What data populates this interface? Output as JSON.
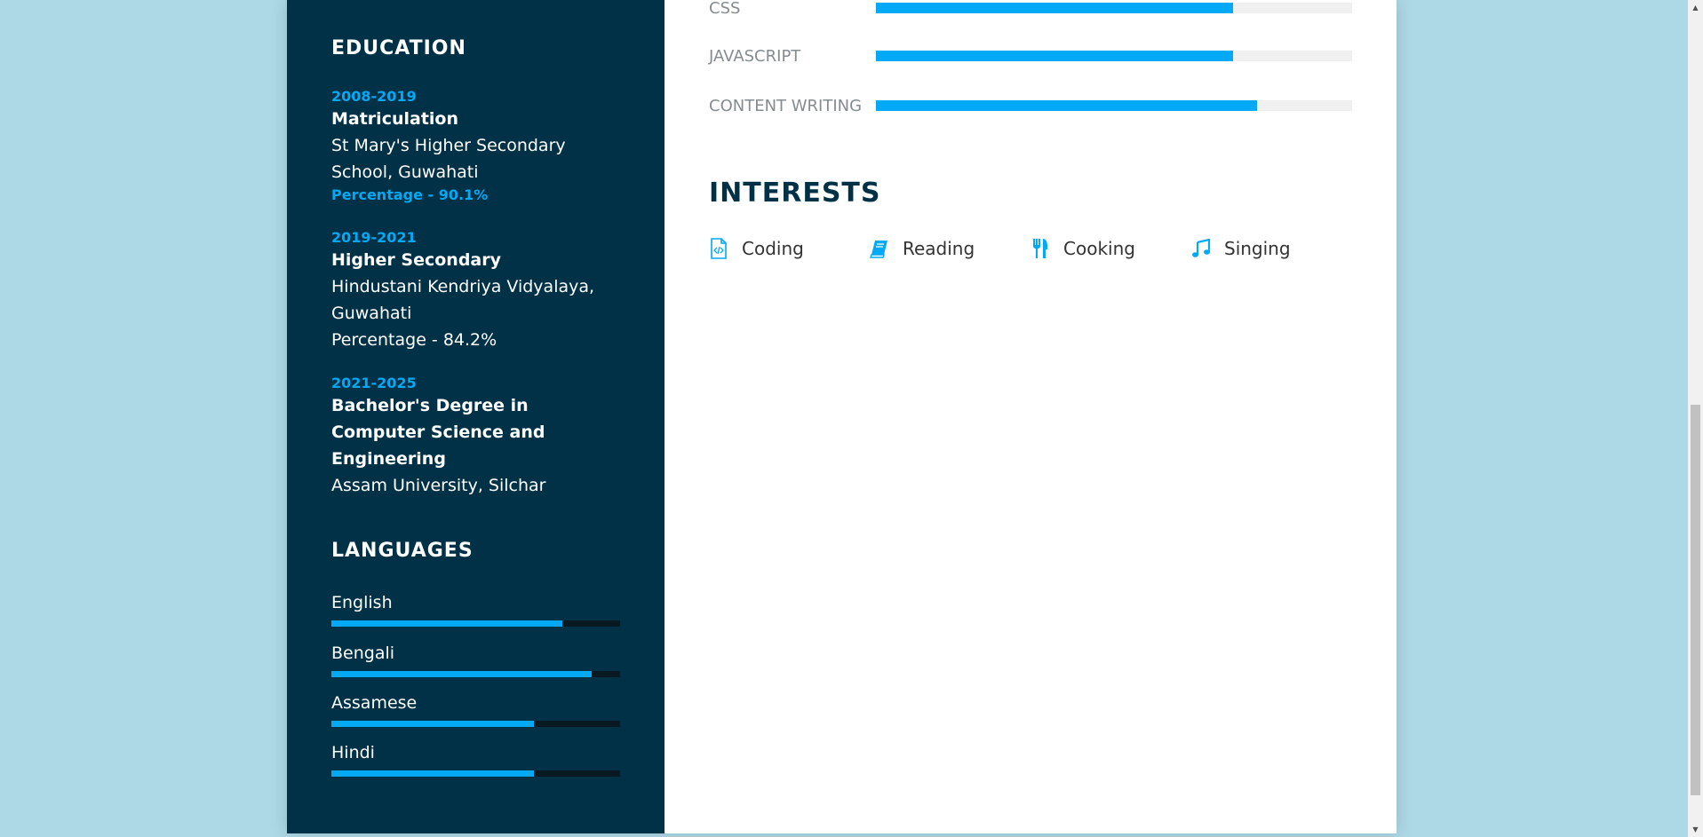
{
  "education": {
    "title": "EDUCATION",
    "items": [
      {
        "year": "2008-2019",
        "degree": "Matriculation",
        "school": "St Mary's Higher Secondary School, Guwahati",
        "percentage": "Percentage - 90.1%"
      },
      {
        "year": "2019-2021",
        "degree": "Higher Secondary",
        "school": "Hindustani Kendriya Vidyalaya, Guwahati",
        "percentage": "Percentage - 84.2%"
      },
      {
        "year": "2021-2025",
        "degree": "Bachelor's Degree in Computer Science and Engineering",
        "school": "Assam University, Silchar"
      }
    ]
  },
  "languages": {
    "title": "LANGUAGES",
    "items": [
      {
        "name": "English",
        "level_percent": 80
      },
      {
        "name": "Bengali",
        "level_percent": 90
      },
      {
        "name": "Assamese",
        "level_percent": 70
      },
      {
        "name": "Hindi",
        "level_percent": 70
      }
    ]
  },
  "skills": [
    {
      "name": "CSS",
      "level_percent": 75
    },
    {
      "name": "JAVASCRIPT",
      "level_percent": 75
    },
    {
      "name": "CONTENT WRITING",
      "level_percent": 80
    }
  ],
  "interests": {
    "title": "INTERESTS",
    "items": [
      {
        "label": "Coding",
        "icon": "code-file-icon"
      },
      {
        "label": "Reading",
        "icon": "book-icon"
      },
      {
        "label": "Cooking",
        "icon": "utensils-icon"
      },
      {
        "label": "Singing",
        "icon": "music-note-icon"
      }
    ]
  },
  "colors": {
    "background": "#add8e6",
    "sidebar": "#003147",
    "accent": "#03a9f4",
    "track_dark": "#081921",
    "track_light": "#f0f0f0"
  }
}
